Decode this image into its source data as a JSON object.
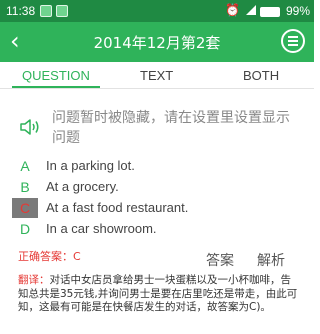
{
  "status_bar": {
    "time": "11:38",
    "battery_percent": "99%"
  },
  "header": {
    "back_icon": "chevron-left-icon",
    "title": "2014年12月第2套",
    "menu_icon": "menu-icon"
  },
  "tabs": [
    {
      "label": "QUESTION",
      "active": true
    },
    {
      "label": "TEXT",
      "active": false
    },
    {
      "label": "BOTH",
      "active": false
    }
  ],
  "notice": {
    "icon": "speaker-icon",
    "text": "问题暂时被隐藏，请在设置里设置显示问题"
  },
  "options": [
    {
      "letter": "A",
      "text": "In a parking lot.",
      "selected": false
    },
    {
      "letter": "B",
      "text": "At a grocery.",
      "selected": false
    },
    {
      "letter": "C",
      "text": "At a fast food restaurant.",
      "selected": true
    },
    {
      "letter": "D",
      "text": "In a car showroom.",
      "selected": false
    }
  ],
  "correct_answer": "正确答案：C",
  "buttons": {
    "answer": "答案",
    "explain": "解析"
  },
  "translation": {
    "label": "翻译：",
    "text": "对话中女店员拿给男士一块蛋糕以及一小杯咖啡，告知总共是35元钱,并询问男士是要在店里吃还是带走，由此可知，这最有可能是在快餐店发生的对话，故答案为C)。"
  },
  "colors": {
    "status_bar": "#1f8a43",
    "header": "#2fb35a",
    "accent_green": "#2fb35a",
    "correct_red": "#e53935",
    "selected_bg": "#7a7a7a"
  }
}
